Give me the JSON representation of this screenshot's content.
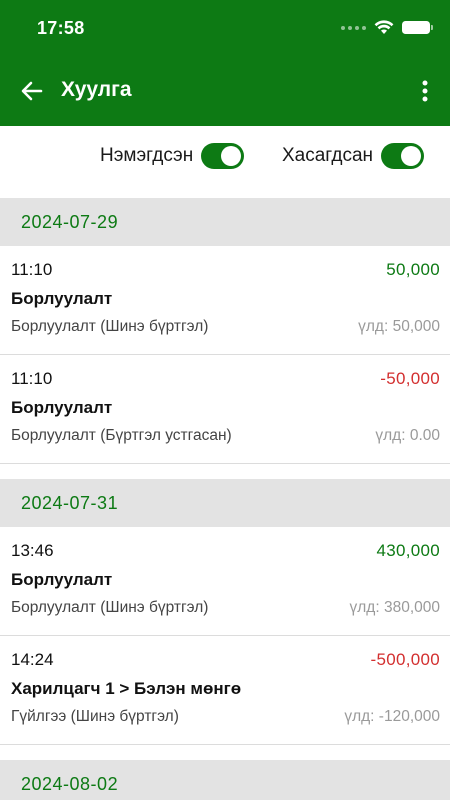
{
  "status_bar": {
    "time": "17:58",
    "icons": [
      "signal-dots-icon",
      "wifi-icon",
      "battery-icon"
    ]
  },
  "app_bar": {
    "title": "Хуулга",
    "back_icon": "arrow-left-icon",
    "menu_icon": "more-vertical-icon"
  },
  "filters": {
    "added": {
      "label": "Нэмэгдсэн",
      "on": true
    },
    "removed": {
      "label": "Хасагдсан",
      "on": true
    }
  },
  "colors": {
    "primary": "#0d7a14",
    "positive": "#0d7a14",
    "negative": "#d32f2f",
    "date_header_bg": "#e3e3e3"
  },
  "groups": [
    {
      "date": "2024-07-29",
      "items": [
        {
          "time": "11:10",
          "amount": "50,000",
          "sign": "pos",
          "title": "Борлуулалт",
          "desc": "Борлуулалт (Шинэ бүртгэл)",
          "balance": "үлд: 50,000"
        },
        {
          "time": "11:10",
          "amount": "-50,000",
          "sign": "neg",
          "title": "Борлуулалт",
          "desc": "Борлуулалт (Бүртгэл устгасан)",
          "balance": "үлд: 0.00"
        }
      ]
    },
    {
      "date": "2024-07-31",
      "items": [
        {
          "time": "13:46",
          "amount": "430,000",
          "sign": "pos",
          "title": "Борлуулалт",
          "desc": "Борлуулалт (Шинэ бүртгэл)",
          "balance": "үлд: 380,000"
        },
        {
          "time": "14:24",
          "amount": "-500,000",
          "sign": "neg",
          "title": "Харилцагч 1 > Бэлэн мөнгө",
          "desc": "Гүйлгээ (Шинэ бүртгэл)",
          "balance": "үлд: -120,000"
        }
      ]
    },
    {
      "date": "2024-08-02",
      "items": []
    }
  ]
}
